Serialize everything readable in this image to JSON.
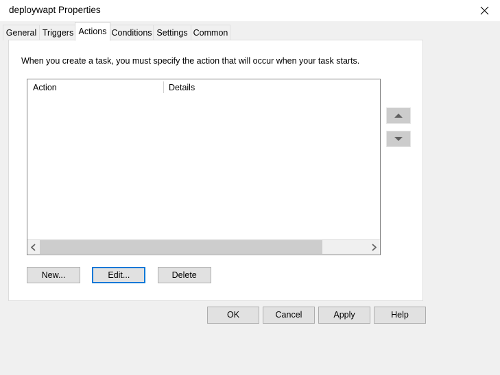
{
  "window": {
    "title": "deploywapt Properties",
    "close_icon": "close-icon"
  },
  "tabs": [
    {
      "label": "General",
      "selected": false
    },
    {
      "label": "Triggers",
      "selected": false
    },
    {
      "label": "Actions",
      "selected": true
    },
    {
      "label": "Conditions",
      "selected": false
    },
    {
      "label": "Settings",
      "selected": false
    },
    {
      "label": "Common",
      "selected": false
    }
  ],
  "main": {
    "instruction": "When you create a task, you must specify the action that will occur when your task starts.",
    "list": {
      "columns": [
        {
          "label": "Action"
        },
        {
          "label": "Details"
        }
      ],
      "rows": [],
      "scrollbar": {
        "left_arrow_icon": "chevron-left-icon",
        "right_arrow_icon": "chevron-right-icon",
        "thumb_percent": 84
      }
    },
    "reorder": {
      "move_up_icon": "triangle-up-icon",
      "move_down_icon": "triangle-down-icon"
    },
    "buttons": {
      "new": "New...",
      "edit": "Edit...",
      "delete": "Delete"
    }
  },
  "footer": {
    "ok": "OK",
    "cancel": "Cancel",
    "apply": "Apply",
    "help": "Help"
  },
  "colors": {
    "focus": "#0078d7",
    "window_bg": "#f0f0f0",
    "panel_bg": "#ffffff",
    "button_face": "#e1e1e1"
  }
}
